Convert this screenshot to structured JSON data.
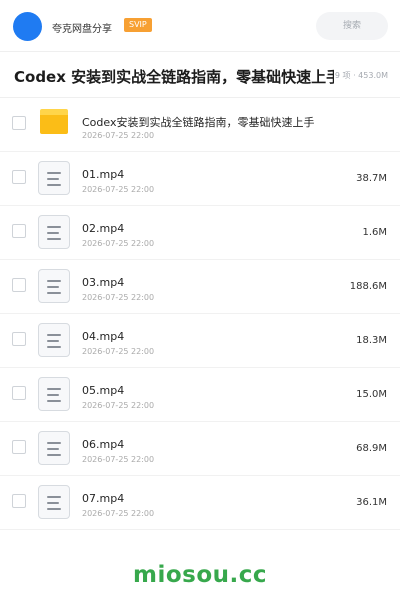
{
  "header": {
    "share_name": "夸克网盘分享",
    "badge": "SVIP",
    "search_placeholder": "搜索",
    "accent_color": "#1f7bf2",
    "badge_color": "#f7a033"
  },
  "title_bar": {
    "title": "Codex 安装到实战全链路指南，零基础快速上手",
    "summary": "9 项 · 453.0M"
  },
  "files": [
    {
      "type": "folder",
      "icon": "folder-icon",
      "name": "Codex安装到实战全链路指南，零基础快速上手",
      "date": "2026-07-25 22:00",
      "size": ""
    },
    {
      "type": "file",
      "icon": "file-icon",
      "name": "01.mp4",
      "date": "2026-07-25 22:00",
      "size": "38.7M"
    },
    {
      "type": "file",
      "icon": "file-icon",
      "name": "02.mp4",
      "date": "2026-07-25 22:00",
      "size": "1.6M"
    },
    {
      "type": "file",
      "icon": "file-icon",
      "name": "03.mp4",
      "date": "2026-07-25 22:00",
      "size": "188.6M"
    },
    {
      "type": "file",
      "icon": "file-icon",
      "name": "04.mp4",
      "date": "2026-07-25 22:00",
      "size": "18.3M"
    },
    {
      "type": "file",
      "icon": "file-icon",
      "name": "05.mp4",
      "date": "2026-07-25 22:00",
      "size": "15.0M"
    },
    {
      "type": "file",
      "icon": "file-icon",
      "name": "06.mp4",
      "date": "2026-07-25 22:00",
      "size": "68.9M"
    },
    {
      "type": "file",
      "icon": "file-icon",
      "name": "07.mp4",
      "date": "2026-07-25 22:00",
      "size": "36.1M"
    }
  ],
  "watermark": {
    "text": "miosou.cc",
    "color": "#37a84c"
  }
}
